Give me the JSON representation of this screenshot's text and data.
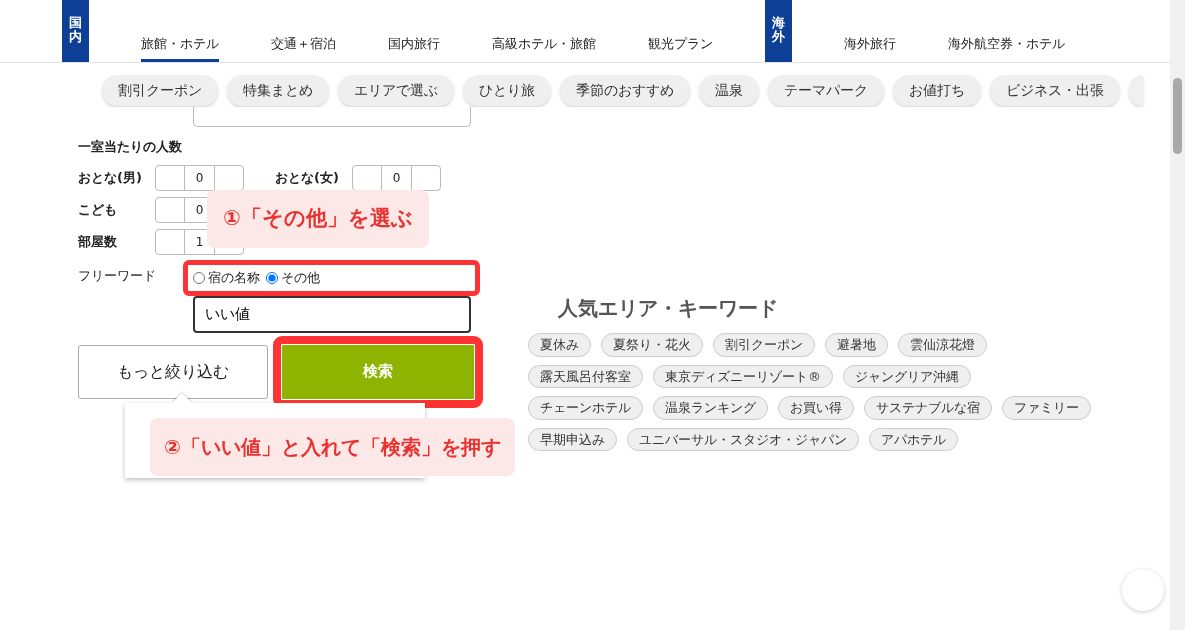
{
  "nav_groups": [
    {
      "badge": "国内",
      "tabs": [
        {
          "label": "旅館・ホテル",
          "selected": true
        },
        {
          "label": "交通＋宿泊",
          "selected": false
        },
        {
          "label": "国内旅行",
          "selected": false
        },
        {
          "label": "高級ホテル・旅館",
          "selected": false
        },
        {
          "label": "観光プラン",
          "selected": false
        }
      ]
    },
    {
      "badge": "海外",
      "tabs": [
        {
          "label": "海外旅行",
          "selected": false
        },
        {
          "label": "海外航空券・ホテル",
          "selected": false
        }
      ]
    }
  ],
  "chips": [
    "割引クーポン",
    "特集まとめ",
    "エリアで選ぶ",
    "ひとり旅",
    "季節のおすすめ",
    "温泉",
    "テーマパーク",
    "お値打ち",
    "ビジネス・出張"
  ],
  "guests": {
    "title": "一室当たりの人数",
    "rows": [
      [
        {
          "label": "おとな(男)",
          "value": "0"
        },
        {
          "label": "おとな(女)",
          "value": "0"
        }
      ],
      [
        {
          "label": "こども",
          "value": "0"
        }
      ],
      [
        {
          "label": "部屋数",
          "value": "1"
        }
      ]
    ]
  },
  "freeword": {
    "label": "フリーワード",
    "options": [
      {
        "label": "宿の名称",
        "selected": false
      },
      {
        "label": "その他",
        "selected": true
      }
    ],
    "value": "いい値"
  },
  "buttons": {
    "refine": "もっと絞り込む",
    "search": "検索"
  },
  "popular": {
    "title": "人気エリア・キーワード",
    "tags": [
      "夏休み",
      "夏祭り・花火",
      "割引クーポン",
      "避暑地",
      "雲仙涼花燈",
      "露天風呂付客室",
      "東京ディズニーリゾート®",
      "ジャングリア沖縄",
      "チェーンホテル",
      "温泉ランキング",
      "お買い得",
      "サステナブルな宿",
      "ファミリー",
      "早期申込み",
      "ユニバーサル・スタジオ・ジャパン",
      "アパホテル"
    ]
  },
  "callouts": [
    {
      "text": "①「その他」を選ぶ"
    },
    {
      "text": "②「いい値」と入れて「検索」を押す"
    }
  ]
}
